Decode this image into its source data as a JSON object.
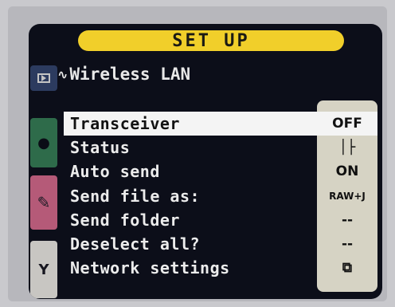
{
  "title": "SET UP",
  "section": {
    "icon": "wireless-wave-icon",
    "icon_glyph": "∿",
    "label": "Wireless LAN"
  },
  "tabs": [
    {
      "name": "playback",
      "icon": "playback-icon"
    },
    {
      "name": "shooting",
      "icon": "camera-icon"
    },
    {
      "name": "custom",
      "icon": "pencil-icon"
    },
    {
      "name": "setup",
      "icon": "wrench-icon"
    }
  ],
  "menu": [
    {
      "label": "Transceiver",
      "value": "OFF",
      "selected": true
    },
    {
      "label": "Status",
      "value": "│├"
    },
    {
      "label": "Auto send",
      "value": "ON"
    },
    {
      "label": "Send file as:",
      "value": "RAW+J"
    },
    {
      "label": "Send folder",
      "value": "--"
    },
    {
      "label": "Deselect all?",
      "value": "--"
    },
    {
      "label": "Network settings",
      "value": "⧉"
    }
  ],
  "colors": {
    "title_bar": "#f1cf2a",
    "screen_bg": "#0c0e19",
    "value_panel": "#d6d3c4",
    "selected_row": "#f4f4f4"
  }
}
